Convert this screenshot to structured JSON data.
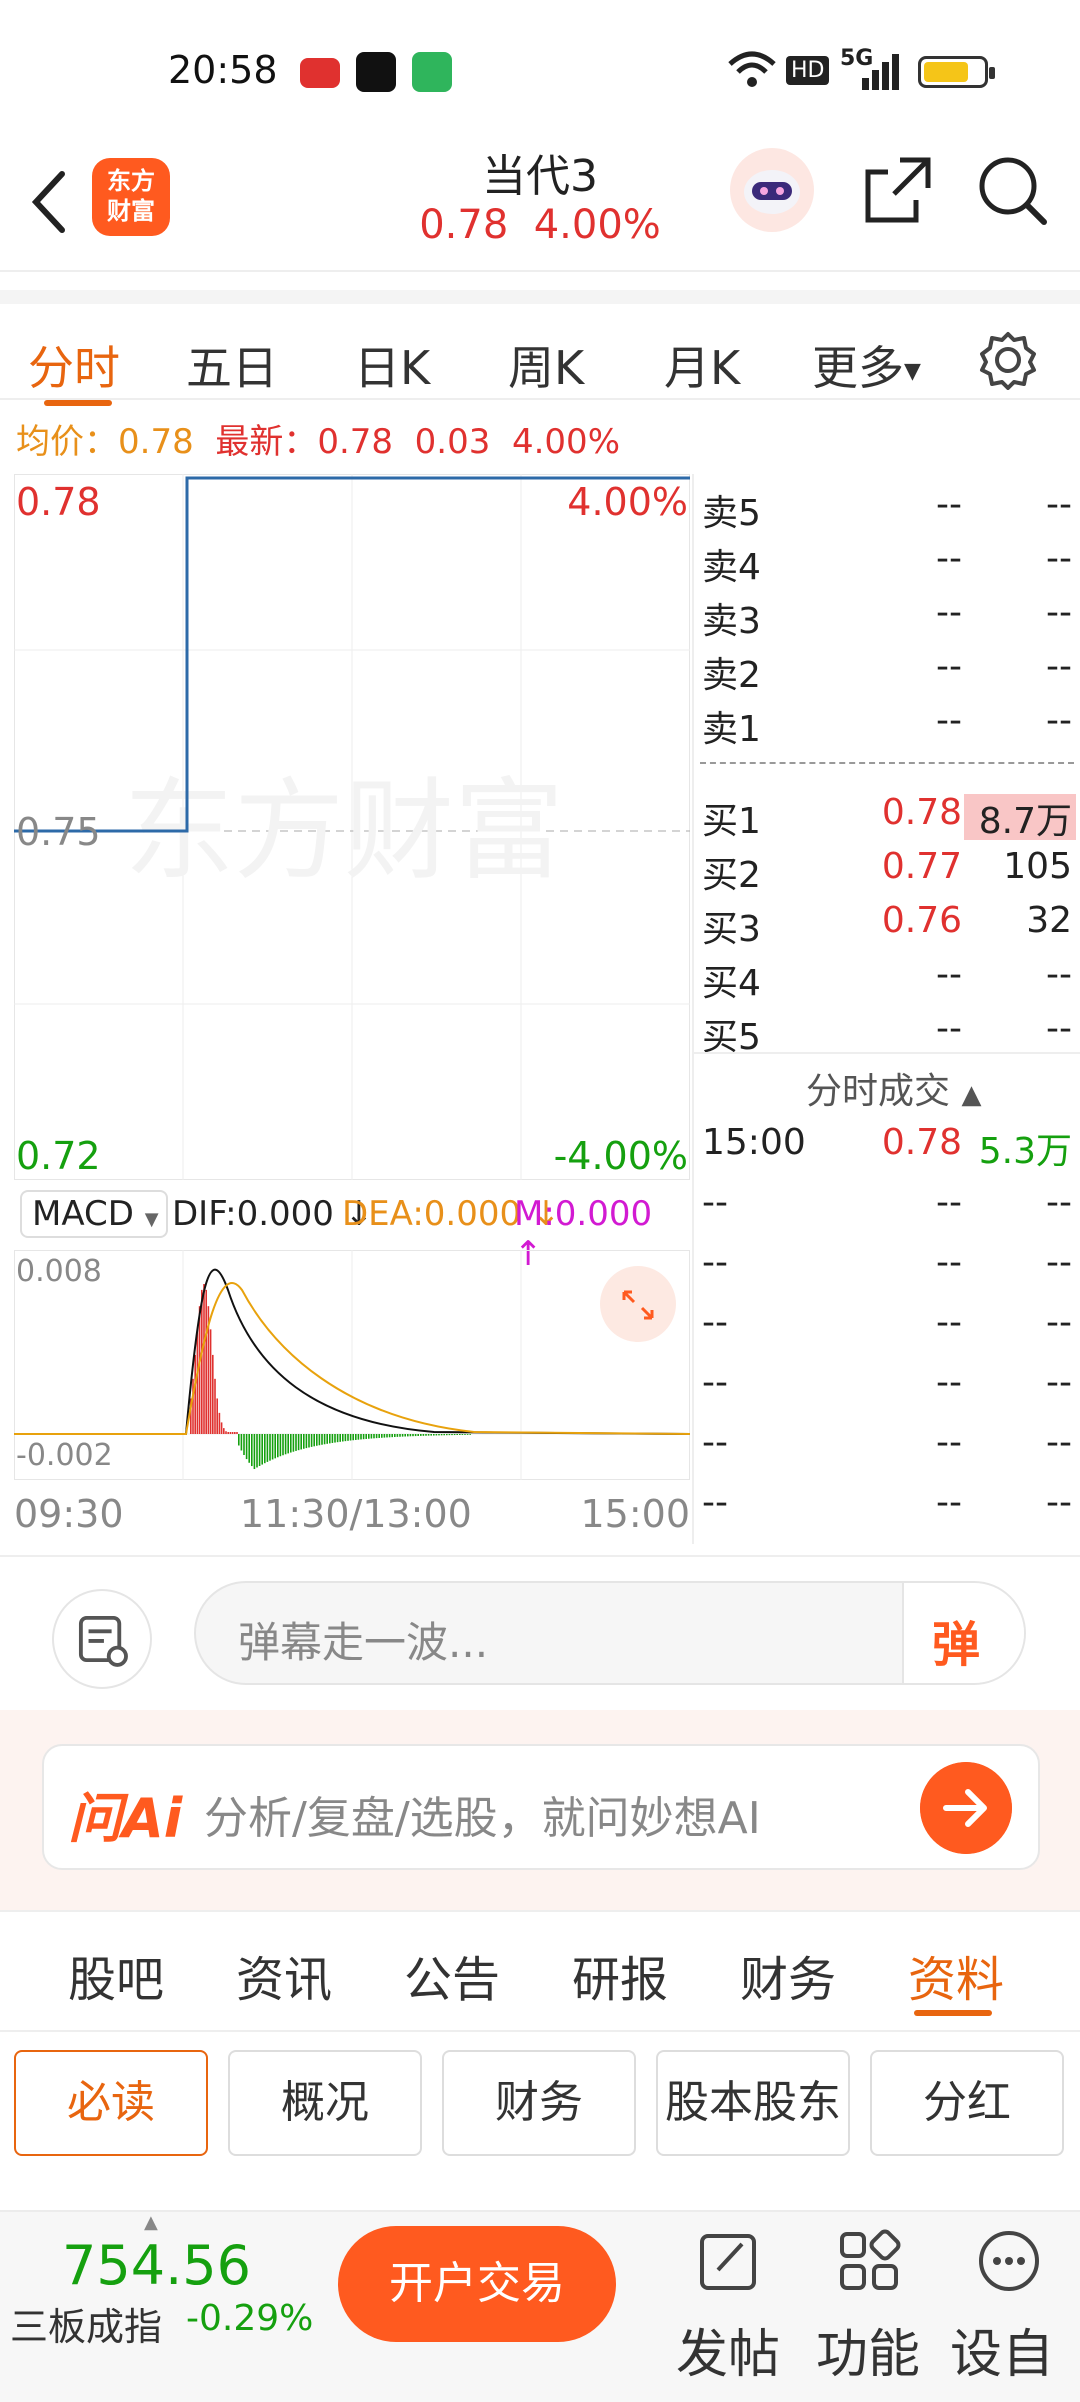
{
  "status_bar": {
    "time": "20:58",
    "network": "5G",
    "hd": "HD"
  },
  "header": {
    "title": "当代3",
    "price": "0.78",
    "change_pct": "4.00%",
    "logo_text_1": "东方",
    "logo_text_2": "财富"
  },
  "tabs": {
    "items": [
      "分时",
      "五日",
      "日K",
      "周K",
      "月K",
      "更多"
    ],
    "active": "分时"
  },
  "avg_line": {
    "avg_label": "均价：",
    "avg_value": "0.78",
    "last_label": "最新：",
    "last_value": "0.78",
    "change": "0.03",
    "change_pct": "4.00%"
  },
  "intraday": {
    "y_top": "0.78",
    "y_mid": "0.75",
    "y_bot": "0.72",
    "pct_top": "4.00%",
    "pct_bot": "-4.00%",
    "watermark": "东方财富"
  },
  "macd": {
    "selector": "MACD",
    "dif": "DIF:0.000",
    "dea": "DEA:0.000",
    "m": "M:0.000",
    "y_top": "0.008",
    "y_bot": "-0.002"
  },
  "time_axis": {
    "start": "09:30",
    "mid": "11:30/13:00",
    "end": "15:00"
  },
  "order_book": {
    "asks": [
      {
        "name": "卖5",
        "price": "--",
        "vol": "--"
      },
      {
        "name": "卖4",
        "price": "--",
        "vol": "--"
      },
      {
        "name": "卖3",
        "price": "--",
        "vol": "--"
      },
      {
        "name": "卖2",
        "price": "--",
        "vol": "--"
      },
      {
        "name": "卖1",
        "price": "--",
        "vol": "--"
      }
    ],
    "bids": [
      {
        "name": "买1",
        "price": "0.78",
        "vol": "8.7万"
      },
      {
        "name": "买2",
        "price": "0.77",
        "vol": "105"
      },
      {
        "name": "买3",
        "price": "0.76",
        "vol": "32"
      },
      {
        "name": "买4",
        "price": "--",
        "vol": "--"
      },
      {
        "name": "买5",
        "price": "--",
        "vol": "--"
      }
    ],
    "ticks_title": "分时成交",
    "ticks": [
      {
        "time": "15:00",
        "price": "0.78",
        "vol": "5.3万"
      },
      {
        "time": "--",
        "price": "--",
        "vol": "--"
      },
      {
        "time": "--",
        "price": "--",
        "vol": "--"
      },
      {
        "time": "--",
        "price": "--",
        "vol": "--"
      },
      {
        "time": "--",
        "price": "--",
        "vol": "--"
      },
      {
        "time": "--",
        "price": "--",
        "vol": "--"
      },
      {
        "time": "--",
        "price": "--",
        "vol": "--"
      }
    ]
  },
  "danmaku": {
    "placeholder": "弹幕走一波...",
    "send": "弹"
  },
  "ai": {
    "logo": "问Ai",
    "prompt": "分析/复盘/选股，就问妙想AI"
  },
  "info_tabs": {
    "items": [
      "股吧",
      "资讯",
      "公告",
      "研报",
      "财务",
      "资料"
    ],
    "active": "资料"
  },
  "sub_tabs": {
    "items": [
      "必读",
      "概况",
      "财务",
      "股本股东",
      "分红"
    ],
    "active": "必读"
  },
  "bottom": {
    "index_value": "754.56",
    "index_name": "三板成指",
    "index_change": "-0.29%",
    "trade": "开户交易",
    "post": "发帖",
    "func": "功能",
    "settings": "设自"
  },
  "colors": {
    "up": "#e0312f",
    "down": "#15a00f",
    "accent": "#ff5a1f",
    "avg": "#e8901a"
  }
}
